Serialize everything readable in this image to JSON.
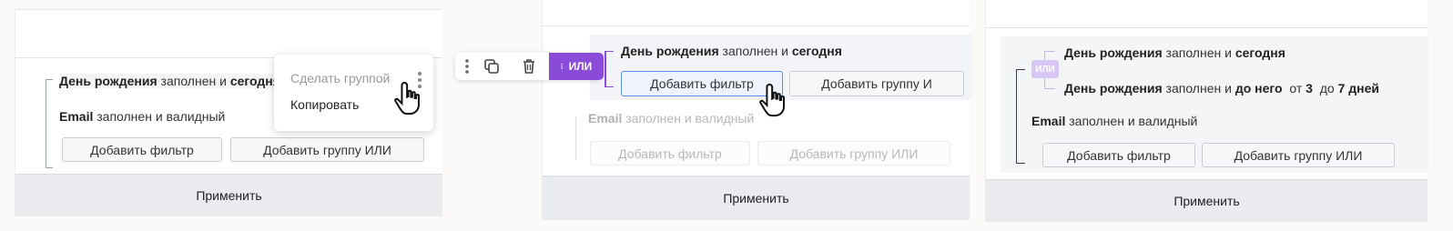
{
  "apply_label": "Применить",
  "frame1": {
    "cond_birthday": {
      "field": "День рождения",
      "op": "заполнен и",
      "value": "сегодня"
    },
    "cond_email": {
      "field": "Email",
      "op": "заполнен и валидный"
    },
    "add_filter": "Добавить фильтр",
    "add_group_or": "Добавить группу ИЛИ",
    "menu": {
      "make_group": "Сделать группой",
      "copy": "Копировать"
    }
  },
  "frame2": {
    "toolbar": {
      "or_badge": "ИЛИ"
    },
    "cond_birthday": {
      "field": "День рождения",
      "op": "заполнен и",
      "value": "сегодня"
    },
    "add_filter": "Добавить фильтр",
    "add_group_and": "Добавить группу И",
    "cond_email": {
      "field": "Email",
      "op": "заполнен и валидный"
    },
    "add_filter_outer": "Добавить фильтр",
    "add_group_or": "Добавить группу ИЛИ"
  },
  "frame3": {
    "or_badge": "ИЛИ",
    "cond_birthday_today": {
      "field": "День рождения",
      "op": "заполнен и",
      "value": "сегодня"
    },
    "cond_birthday_range": {
      "field": "День рождения",
      "op": "заполнен и",
      "value": "до него",
      "from_label": "от",
      "from": "3",
      "to_label": "до",
      "to": "7 дней"
    },
    "cond_email": {
      "field": "Email",
      "op": "заполнен и валидный"
    },
    "add_filter": "Добавить фильтр",
    "add_group_or": "Добавить группу ИЛИ"
  }
}
